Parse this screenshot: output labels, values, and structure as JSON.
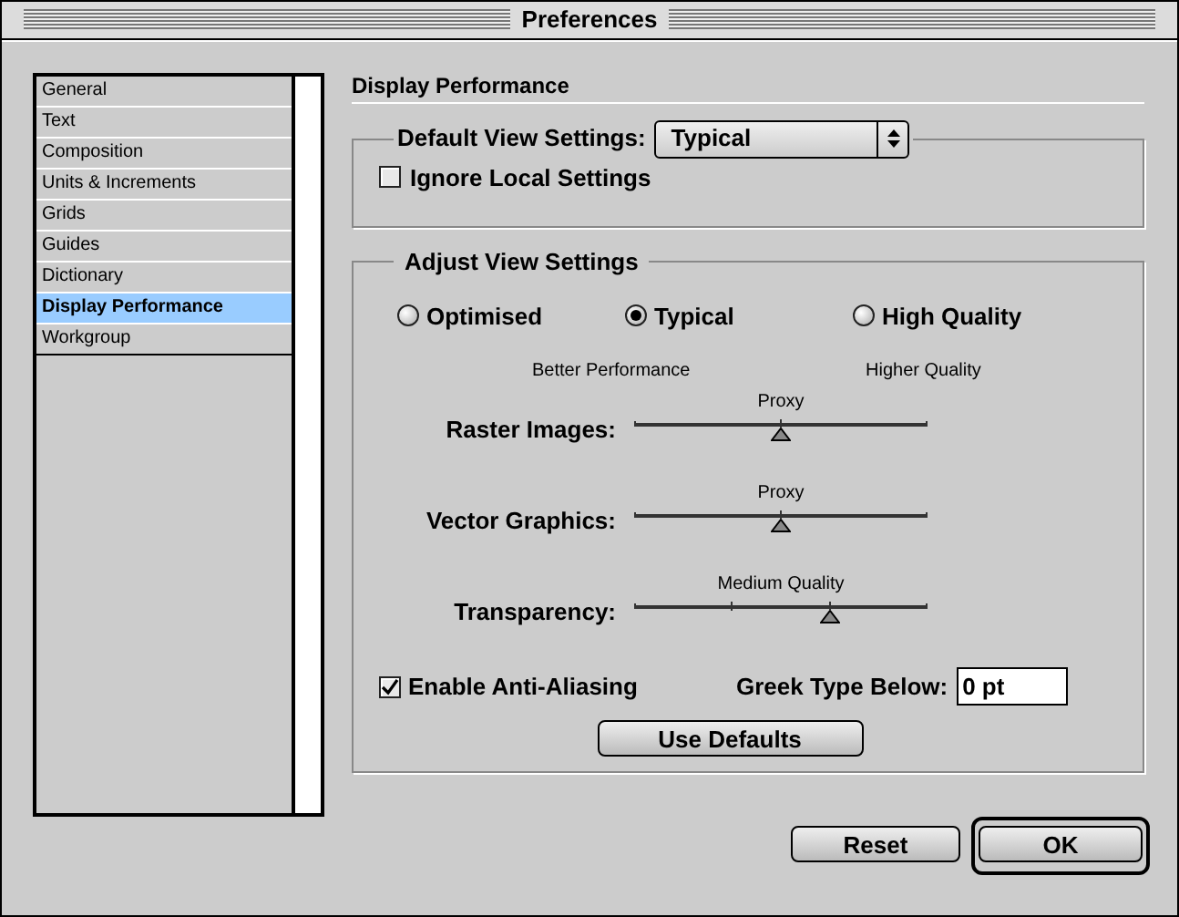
{
  "window": {
    "title": "Preferences"
  },
  "sidebar": {
    "items": [
      {
        "label": "General",
        "selected": false
      },
      {
        "label": "Text",
        "selected": false
      },
      {
        "label": "Composition",
        "selected": false
      },
      {
        "label": "Units & Increments",
        "selected": false
      },
      {
        "label": "Grids",
        "selected": false
      },
      {
        "label": "Guides",
        "selected": false
      },
      {
        "label": "Dictionary",
        "selected": false
      },
      {
        "label": "Display Performance",
        "selected": true
      },
      {
        "label": "Workgroup",
        "selected": false
      }
    ]
  },
  "panel": {
    "title": "Display Performance",
    "default_view": {
      "label": "Default View Settings:",
      "value": "Typical",
      "ignore_local": {
        "label": "Ignore Local Settings",
        "checked": false
      }
    },
    "adjust": {
      "title": "Adjust View Settings",
      "presets": [
        {
          "label": "Optimised",
          "selected": false
        },
        {
          "label": "Typical",
          "selected": true
        },
        {
          "label": "High Quality",
          "selected": false
        }
      ],
      "scale_left": "Better Performance",
      "scale_right": "Higher Quality",
      "sliders": [
        {
          "label": "Raster Images:",
          "reading": "Proxy",
          "kind": "three-stop",
          "level": 0.5
        },
        {
          "label": "Vector Graphics:",
          "reading": "Proxy",
          "kind": "three-stop",
          "level": 0.5
        },
        {
          "label": "Transparency:",
          "reading": "Medium Quality",
          "kind": "four-stop",
          "level": 0.667
        }
      ],
      "anti_aliasing": {
        "label": "Enable Anti-Aliasing",
        "checked": true
      },
      "greek": {
        "label": "Greek Type Below:",
        "value": "0 pt"
      },
      "defaults_button": "Use Defaults"
    }
  },
  "buttons": [
    {
      "label": "Reset",
      "default": false
    },
    {
      "label": "OK",
      "default": true
    }
  ]
}
